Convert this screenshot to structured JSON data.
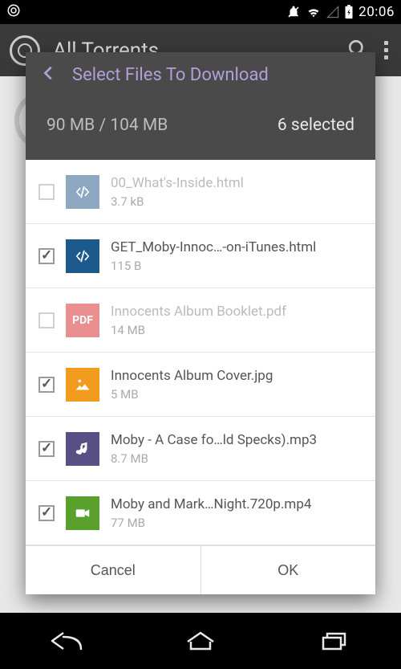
{
  "statusbar": {
    "time": "20:06"
  },
  "appbar": {
    "title": "All Torrents"
  },
  "dialog": {
    "title": "Select Files To Download",
    "size_info": "90 MB / 104 MB",
    "selected_info": "6 selected",
    "cancel_label": "Cancel",
    "ok_label": "OK"
  },
  "files": [
    {
      "name": "00_What's-Inside.html",
      "size": "3.7 kB",
      "checked": false,
      "type": "html",
      "dim": true,
      "icon_bg": "#8fa8c2"
    },
    {
      "name": "GET_Moby-Innoc…-on-iTunes.html",
      "size": "115 B",
      "checked": true,
      "type": "html",
      "dim": false,
      "icon_bg": "#1c5a8e"
    },
    {
      "name": "Innocents Album Booklet.pdf",
      "size": "14 MB",
      "checked": false,
      "type": "pdf",
      "dim": true,
      "icon_bg": "#e98f8f"
    },
    {
      "name": "Innocents Album Cover.jpg",
      "size": "5 MB",
      "checked": true,
      "type": "image",
      "dim": false,
      "icon_bg": "#f29b1d"
    },
    {
      "name": "Moby - A Case fo…ld Specks).mp3",
      "size": "8.7 MB",
      "checked": true,
      "type": "audio",
      "dim": false,
      "icon_bg": "#5a4f84"
    },
    {
      "name": "Moby and Mark…Night.720p.mp4",
      "size": "77 MB",
      "checked": true,
      "type": "video",
      "dim": false,
      "icon_bg": "#5aa02c"
    }
  ]
}
